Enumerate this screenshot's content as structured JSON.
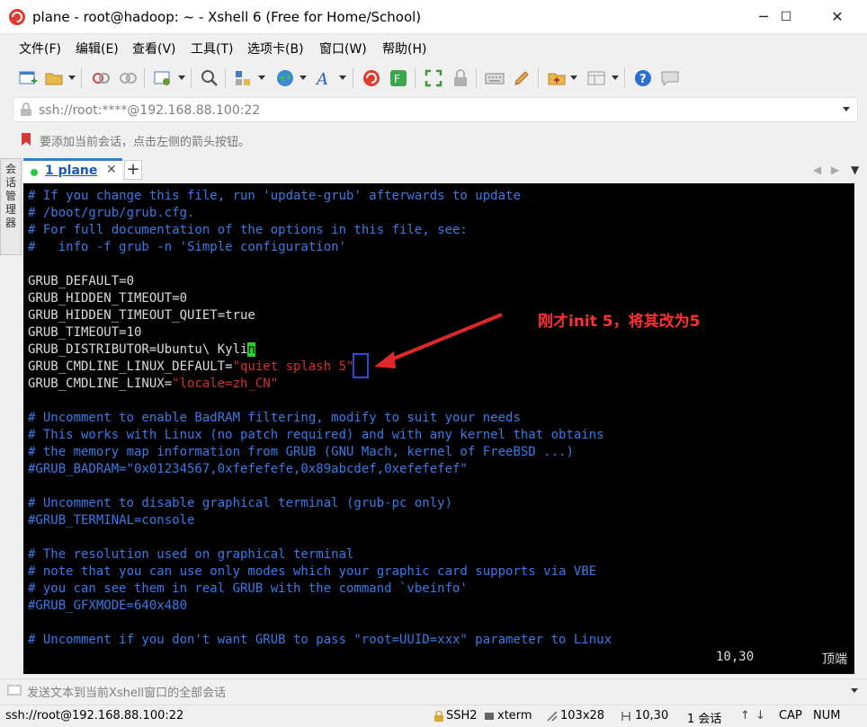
{
  "window": {
    "title": "plane - root@hadoop: ~ - Xshell 6 (Free for Home/School)",
    "minimize": "─",
    "maximize": "☐",
    "close": "✕"
  },
  "menu": [
    "文件(F)",
    "编辑(E)",
    "查看(V)",
    "工具(T)",
    "选项卡(B)",
    "窗口(W)",
    "帮助(H)"
  ],
  "address": {
    "value": "ssh://root:****@192.168.88.100:22"
  },
  "hint": {
    "text": "要添加当前会话，点击左侧的箭头按钮。"
  },
  "side_tab": {
    "label": "会话管理器"
  },
  "tabs": [
    {
      "number": "1",
      "name": "plane",
      "close": "✕"
    }
  ],
  "new_tab": "+",
  "tab_nav": {
    "left": "◀",
    "right": "▶",
    "menu": "▼"
  },
  "terminal": {
    "lines": [
      [
        {
          "t": "# If you change this file, run 'update-grub' afterwards to update",
          "c": "cm"
        }
      ],
      [
        {
          "t": "# /boot/grub/grub.cfg.",
          "c": "cm"
        }
      ],
      [
        {
          "t": "# For full documentation of the options in this file, see:",
          "c": "cm"
        }
      ],
      [
        {
          "t": "#   info -f grub -n 'Simple configuration'",
          "c": "cm"
        }
      ],
      [],
      [
        {
          "t": "GRUB_DEFAULT=0",
          "c": "st"
        }
      ],
      [
        {
          "t": "GRUB_HIDDEN_TIMEOUT=0",
          "c": "st"
        }
      ],
      [
        {
          "t": "GRUB_HIDDEN_TIMEOUT_QUIET=true",
          "c": "st"
        }
      ],
      [
        {
          "t": "GRUB_TIMEOUT=10",
          "c": "st"
        }
      ],
      [
        {
          "t": "GRUB_DISTRIBUTOR=Ubuntu\\ Kyli",
          "c": "st"
        },
        {
          "t": "n",
          "c": "cursor"
        }
      ],
      [
        {
          "t": "GRUB_CMDLINE_LINUX_DEFAULT=",
          "c": "st"
        },
        {
          "t": "\"quiet splash 5\"",
          "c": "rd"
        }
      ],
      [
        {
          "t": "GRUB_CMDLINE_LINUX=",
          "c": "st"
        },
        {
          "t": "\"locale=zh_CN\"",
          "c": "rd"
        }
      ],
      [],
      [
        {
          "t": "# Uncomment to enable BadRAM filtering, modify to suit your needs",
          "c": "cm"
        }
      ],
      [
        {
          "t": "# This works with Linux (no patch required) and with any kernel that obtains",
          "c": "cm"
        }
      ],
      [
        {
          "t": "# the memory map information from GRUB (GNU Mach, kernel of FreeBSD ...)",
          "c": "cm"
        }
      ],
      [
        {
          "t": "#GRUB_BADRAM=\"0x01234567,0xfefefefe,0x89abcdef,0xefefefef\"",
          "c": "cm"
        }
      ],
      [],
      [
        {
          "t": "# Uncomment to disable graphical terminal (grub-pc only)",
          "c": "cm"
        }
      ],
      [
        {
          "t": "#GRUB_TERMINAL=console",
          "c": "cm"
        }
      ],
      [],
      [
        {
          "t": "# The resolution used on graphical terminal",
          "c": "cm"
        }
      ],
      [
        {
          "t": "# note that you can use only modes which your graphic card supports via VBE",
          "c": "cm"
        }
      ],
      [
        {
          "t": "# you can see them in real GRUB with the command `vbeinfo'",
          "c": "cm"
        }
      ],
      [
        {
          "t": "#GRUB_GFXMODE=640x480",
          "c": "cm"
        }
      ],
      [],
      [
        {
          "t": "# Uncomment if you don't want GRUB to pass \"root=UUID=xxx\" parameter to Linux",
          "c": "cm"
        }
      ]
    ],
    "position": "10,30",
    "scroll": "顶端"
  },
  "annotation": {
    "text": "刚才init 5，将其改为5",
    "color": "#ff3030"
  },
  "send": {
    "text": "发送文本到当前Xshell窗口的全部会话"
  },
  "status": {
    "connection": "ssh://root@192.168.88.100:22",
    "protocol": "SSH2",
    "term": "xterm",
    "size": "103x28",
    "cursor": "10,30",
    "sessions": "1 会话",
    "caps": "CAP",
    "num": "NUM"
  },
  "colors": {
    "comment": "#3a7ae8",
    "string": "#d23030",
    "cursor": "#26d12e",
    "tab_accent": "#2e7dd1"
  }
}
